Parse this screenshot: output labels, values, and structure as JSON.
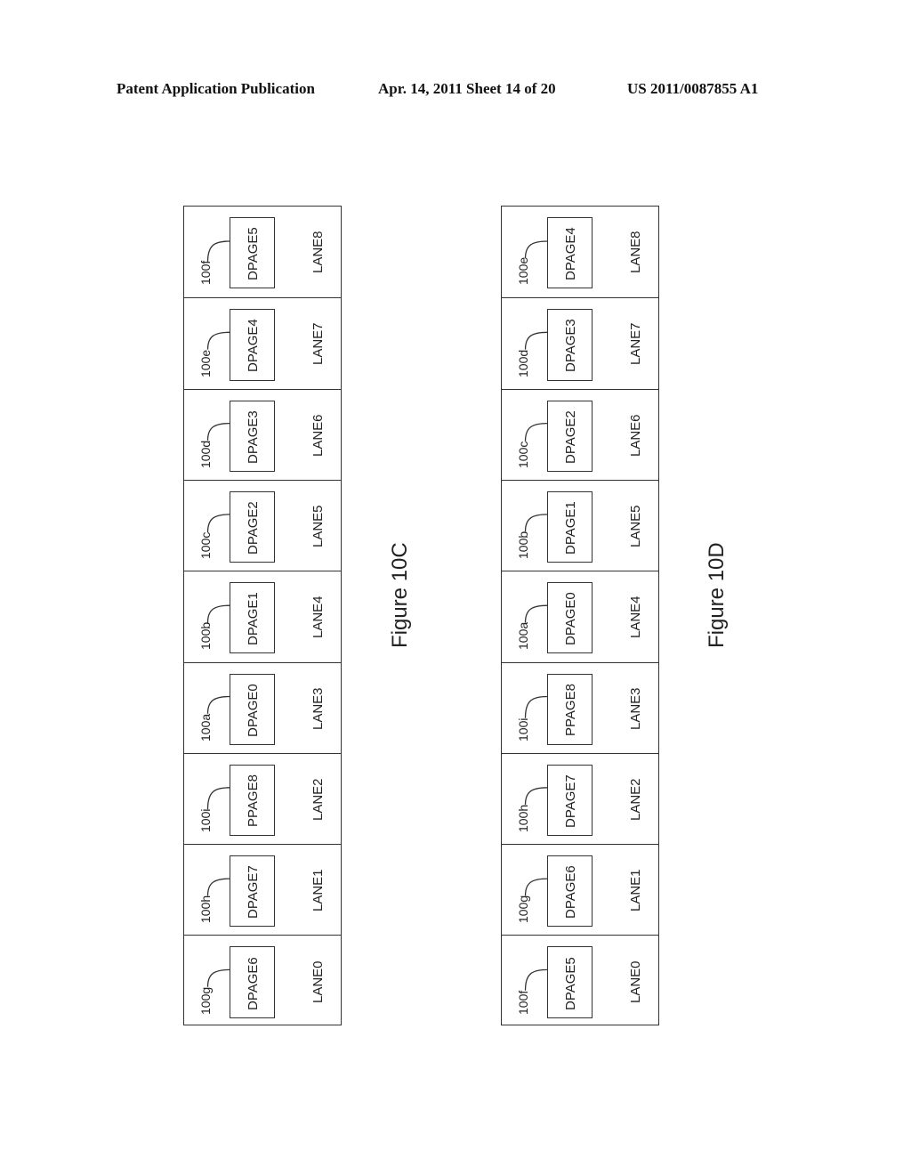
{
  "header": {
    "left": "Patent Application Publication",
    "middle": "Apr. 14, 2011  Sheet 14 of 20",
    "right": "US 2011/0087855 A1"
  },
  "figures": [
    {
      "label": "Figure 10C",
      "lanes": [
        {
          "lane": "LANE8",
          "page": "DPAGE5",
          "ref": "100f"
        },
        {
          "lane": "LANE7",
          "page": "DPAGE4",
          "ref": "100e"
        },
        {
          "lane": "LANE6",
          "page": "DPAGE3",
          "ref": "100d"
        },
        {
          "lane": "LANE5",
          "page": "DPAGE2",
          "ref": "100c"
        },
        {
          "lane": "LANE4",
          "page": "DPAGE1",
          "ref": "100b"
        },
        {
          "lane": "LANE3",
          "page": "DPAGE0",
          "ref": "100a"
        },
        {
          "lane": "LANE2",
          "page": "PPAGE8",
          "ref": "100i"
        },
        {
          "lane": "LANE1",
          "page": "DPAGE7",
          "ref": "100h"
        },
        {
          "lane": "LANE0",
          "page": "DPAGE6",
          "ref": "100g"
        }
      ]
    },
    {
      "label": "Figure 10D",
      "lanes": [
        {
          "lane": "LANE8",
          "page": "DPAGE4",
          "ref": "100e"
        },
        {
          "lane": "LANE7",
          "page": "DPAGE3",
          "ref": "100d"
        },
        {
          "lane": "LANE6",
          "page": "DPAGE2",
          "ref": "100c"
        },
        {
          "lane": "LANE5",
          "page": "DPAGE1",
          "ref": "100b"
        },
        {
          "lane": "LANE4",
          "page": "DPAGE0",
          "ref": "100a"
        },
        {
          "lane": "LANE3",
          "page": "PPAGE8",
          "ref": "100i"
        },
        {
          "lane": "LANE2",
          "page": "DPAGE7",
          "ref": "100h"
        },
        {
          "lane": "LANE1",
          "page": "DPAGE6",
          "ref": "100g"
        },
        {
          "lane": "LANE0",
          "page": "DPAGE5",
          "ref": "100f"
        }
      ]
    }
  ]
}
